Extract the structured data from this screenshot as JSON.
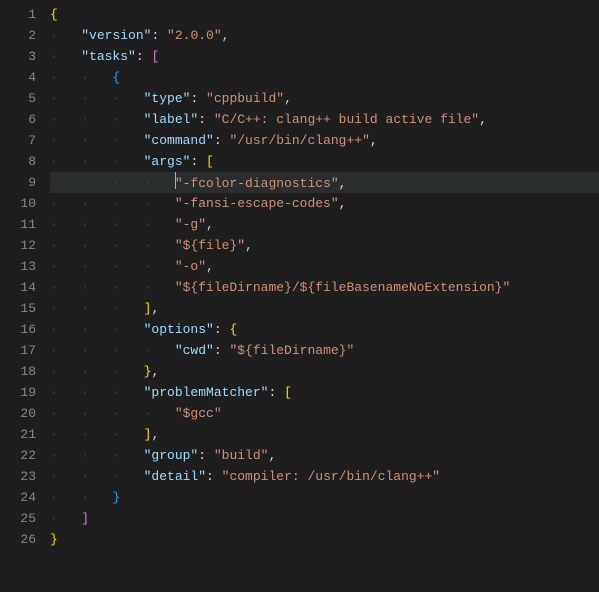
{
  "editor": {
    "highlighted_line_index": 8,
    "line_numbers": [
      "1",
      "2",
      "3",
      "4",
      "5",
      "6",
      "7",
      "8",
      "9",
      "10",
      "11",
      "12",
      "13",
      "14",
      "15",
      "16",
      "17",
      "18",
      "19",
      "20",
      "21",
      "22",
      "23",
      "24",
      "25",
      "26"
    ],
    "lines": [
      {
        "indent": 0,
        "tokens": [
          {
            "t": "{",
            "c": "punc"
          }
        ]
      },
      {
        "indent": 1,
        "tokens": [
          {
            "t": "\"version\"",
            "c": "key"
          },
          {
            "t": ": ",
            "c": "neutral"
          },
          {
            "t": "\"2.0.0\"",
            "c": "str"
          },
          {
            "t": ",",
            "c": "neutral"
          }
        ]
      },
      {
        "indent": 1,
        "tokens": [
          {
            "t": "\"tasks\"",
            "c": "key"
          },
          {
            "t": ": ",
            "c": "neutral"
          },
          {
            "t": "[",
            "c": "punc2"
          }
        ]
      },
      {
        "indent": 2,
        "tokens": [
          {
            "t": "{",
            "c": "punc3"
          }
        ]
      },
      {
        "indent": 3,
        "tokens": [
          {
            "t": "\"type\"",
            "c": "key"
          },
          {
            "t": ": ",
            "c": "neutral"
          },
          {
            "t": "\"cppbuild\"",
            "c": "str"
          },
          {
            "t": ",",
            "c": "neutral"
          }
        ]
      },
      {
        "indent": 3,
        "tokens": [
          {
            "t": "\"label\"",
            "c": "key"
          },
          {
            "t": ": ",
            "c": "neutral"
          },
          {
            "t": "\"C/C++: clang++ build active file\"",
            "c": "str"
          },
          {
            "t": ",",
            "c": "neutral"
          }
        ]
      },
      {
        "indent": 3,
        "tokens": [
          {
            "t": "\"command\"",
            "c": "key"
          },
          {
            "t": ": ",
            "c": "neutral"
          },
          {
            "t": "\"/usr/bin/clang++\"",
            "c": "str"
          },
          {
            "t": ",",
            "c": "neutral"
          }
        ]
      },
      {
        "indent": 3,
        "tokens": [
          {
            "t": "\"args\"",
            "c": "key"
          },
          {
            "t": ": ",
            "c": "neutral"
          },
          {
            "t": "[",
            "c": "punc"
          }
        ]
      },
      {
        "indent": 4,
        "cursor": true,
        "tokens": [
          {
            "t": "\"-fcolor-diagnostics\"",
            "c": "str"
          },
          {
            "t": ",",
            "c": "neutral"
          }
        ]
      },
      {
        "indent": 4,
        "tokens": [
          {
            "t": "\"-fansi-escape-codes\"",
            "c": "str"
          },
          {
            "t": ",",
            "c": "neutral"
          }
        ]
      },
      {
        "indent": 4,
        "tokens": [
          {
            "t": "\"-g\"",
            "c": "str"
          },
          {
            "t": ",",
            "c": "neutral"
          }
        ]
      },
      {
        "indent": 4,
        "tokens": [
          {
            "t": "\"${file}\"",
            "c": "str"
          },
          {
            "t": ",",
            "c": "neutral"
          }
        ]
      },
      {
        "indent": 4,
        "tokens": [
          {
            "t": "\"-o\"",
            "c": "str"
          },
          {
            "t": ",",
            "c": "neutral"
          }
        ]
      },
      {
        "indent": 4,
        "tokens": [
          {
            "t": "\"${fileDirname}/${fileBasenameNoExtension}\"",
            "c": "str"
          }
        ]
      },
      {
        "indent": 3,
        "tokens": [
          {
            "t": "]",
            "c": "punc"
          },
          {
            "t": ",",
            "c": "neutral"
          }
        ]
      },
      {
        "indent": 3,
        "tokens": [
          {
            "t": "\"options\"",
            "c": "key"
          },
          {
            "t": ": ",
            "c": "neutral"
          },
          {
            "t": "{",
            "c": "punc"
          }
        ]
      },
      {
        "indent": 4,
        "tokens": [
          {
            "t": "\"cwd\"",
            "c": "key"
          },
          {
            "t": ": ",
            "c": "neutral"
          },
          {
            "t": "\"${fileDirname}\"",
            "c": "str"
          }
        ]
      },
      {
        "indent": 3,
        "tokens": [
          {
            "t": "}",
            "c": "punc"
          },
          {
            "t": ",",
            "c": "neutral"
          }
        ]
      },
      {
        "indent": 3,
        "tokens": [
          {
            "t": "\"problemMatcher\"",
            "c": "key"
          },
          {
            "t": ": ",
            "c": "neutral"
          },
          {
            "t": "[",
            "c": "punc"
          }
        ]
      },
      {
        "indent": 4,
        "tokens": [
          {
            "t": "\"$gcc\"",
            "c": "str"
          }
        ]
      },
      {
        "indent": 3,
        "tokens": [
          {
            "t": "]",
            "c": "punc"
          },
          {
            "t": ",",
            "c": "neutral"
          }
        ]
      },
      {
        "indent": 3,
        "tokens": [
          {
            "t": "\"group\"",
            "c": "key"
          },
          {
            "t": ": ",
            "c": "neutral"
          },
          {
            "t": "\"build\"",
            "c": "str"
          },
          {
            "t": ",",
            "c": "neutral"
          }
        ]
      },
      {
        "indent": 3,
        "tokens": [
          {
            "t": "\"detail\"",
            "c": "key"
          },
          {
            "t": ": ",
            "c": "neutral"
          },
          {
            "t": "\"compiler: /usr/bin/clang++\"",
            "c": "str"
          }
        ]
      },
      {
        "indent": 2,
        "tokens": [
          {
            "t": "}",
            "c": "punc3"
          }
        ]
      },
      {
        "indent": 1,
        "tokens": [
          {
            "t": "]",
            "c": "punc2"
          }
        ]
      },
      {
        "indent": 0,
        "tokens": [
          {
            "t": "}",
            "c": "punc"
          }
        ]
      }
    ]
  }
}
